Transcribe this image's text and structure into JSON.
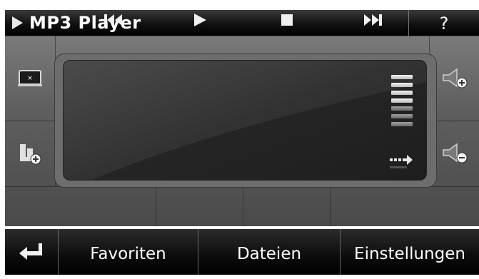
{
  "titlebar": {
    "title": "MP3 Player",
    "help_label": "?"
  },
  "display": {
    "volume_levels_total": 7,
    "volume_level": 4
  },
  "bottom_bar": {
    "favorites_label": "Favoriten",
    "files_label": "Dateien",
    "settings_label": "Einstellungen"
  },
  "icons": {
    "play_title": "play-indicator-icon",
    "screen_off": "screen-off-icon",
    "add_to_favorites": "add-favorite-icon",
    "volume_up": "volume-up-icon",
    "volume_down": "volume-down-icon",
    "previous": "previous-track-icon",
    "play": "play-icon",
    "stop": "stop-icon",
    "next": "next-track-icon",
    "back": "back-arrow-icon",
    "repeat": "repeat-mode-icon"
  },
  "colors": {
    "accent": "#ffffff",
    "panel": "#2a2a2a",
    "background": "#5e5e5e"
  }
}
